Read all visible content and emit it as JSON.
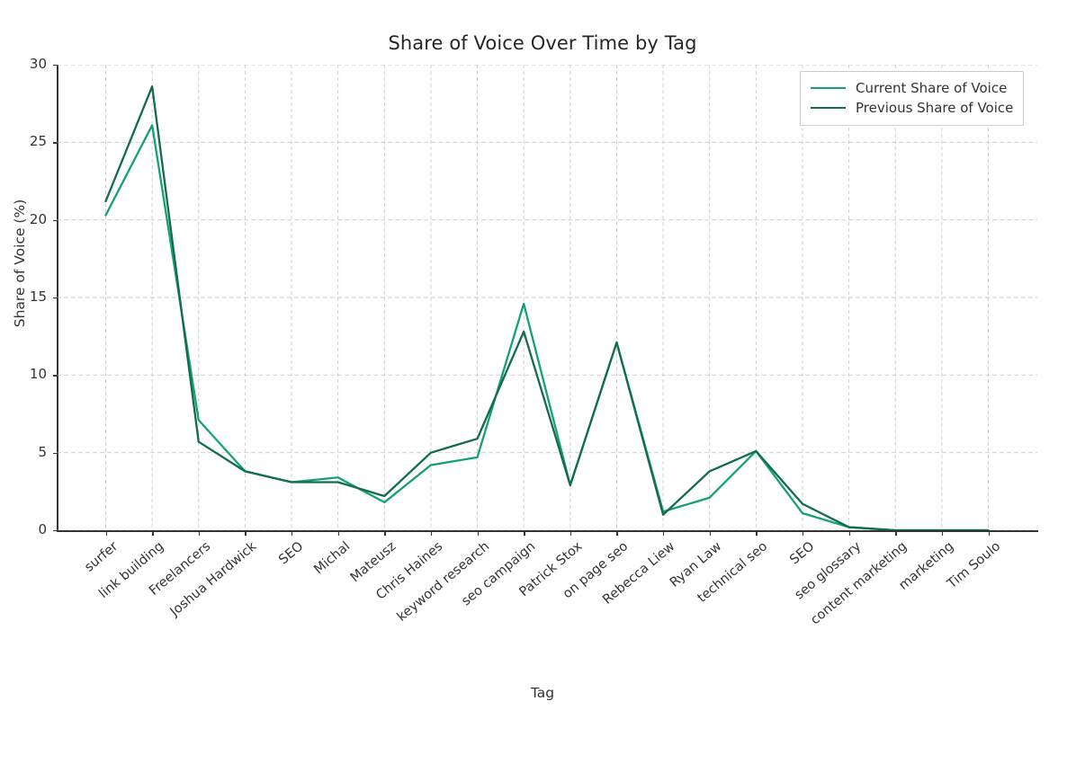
{
  "chart_data": {
    "type": "line",
    "title": "Share of Voice Over Time by Tag",
    "xlabel": "Tag",
    "ylabel": "Share of Voice (%)",
    "ylim": [
      0,
      30
    ],
    "yticks": [
      0,
      5,
      10,
      15,
      20,
      25,
      30
    ],
    "grid": true,
    "legend_position": "upper right",
    "categories": [
      "surfer",
      "link building",
      "Freelancers",
      "Joshua Hardwick",
      "SEO",
      "Michal",
      "Mateusz",
      "Chris Haines",
      "keyword research",
      "seo campaign",
      "Patrick Stox",
      "on page seo",
      "Rebecca Liew",
      "Ryan Law",
      "technical seo",
      "SEO",
      "seo glossary",
      "content marketing",
      "marketing",
      "Tim Soulo"
    ],
    "series": [
      {
        "name": "Current Share of Voice",
        "color": "#15a077",
        "values": [
          20.3,
          26.1,
          7.1,
          3.8,
          3.1,
          3.4,
          1.8,
          4.2,
          4.7,
          14.6,
          2.9,
          12.1,
          1.2,
          2.1,
          5.1,
          1.1,
          0.2,
          0.0,
          0.0,
          0.0
        ]
      },
      {
        "name": "Previous Share of Voice",
        "color": "#136b50",
        "values": [
          21.2,
          28.6,
          5.7,
          3.8,
          3.1,
          3.1,
          2.2,
          5.0,
          5.9,
          12.8,
          2.9,
          12.1,
          1.0,
          3.8,
          5.1,
          1.7,
          0.2,
          0.0,
          0.0,
          0.0
        ]
      }
    ]
  },
  "legend": {
    "items": [
      {
        "label": "Current Share of Voice"
      },
      {
        "label": "Previous Share of Voice"
      }
    ]
  }
}
